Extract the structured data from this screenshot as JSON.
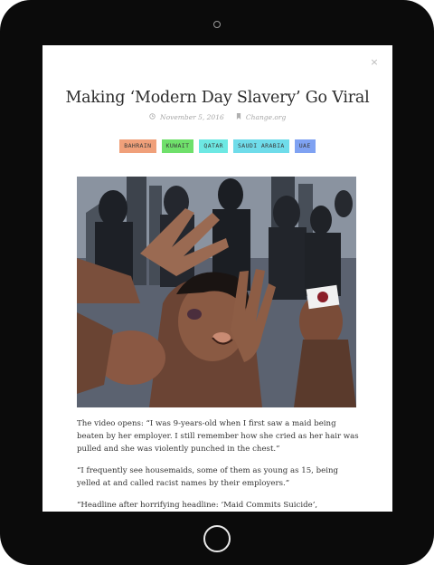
{
  "article": {
    "title": "Making ‘Modern Day Slavery’ Go Viral",
    "date": "November 5, 2016",
    "category": "Change.org",
    "close_icon": "×",
    "tags": [
      {
        "label": "BAHRAIN",
        "color": "#f0a07a"
      },
      {
        "label": "KUWAIT",
        "color": "#6fe06b"
      },
      {
        "label": "QATAR",
        "color": "#6de8e3"
      },
      {
        "label": "SAUDI ARABIA",
        "color": "#6fdcea"
      },
      {
        "label": "UAE",
        "color": "#7fa2f2"
      }
    ],
    "paragraphs": [
      "The video opens: “I was 9-years-old when I first saw a maid being beaten by her employer. I still remember how she cried as her hair was pulled and she was violently punched in the chest.”",
      "“I frequently see housemaids, some of them as young as 15, being yelled at and called racist names by their employers.”",
      "“Headline after horrifying headline: ‘Maid Commits Suicide’, ‘Construction Worker Crushed to Death’, ‘Maid Beaten’, ‘Driver Killed’ – which is"
    ]
  },
  "icons": {
    "clock": "clock-icon",
    "bookmark": "bookmark-icon",
    "close": "close-icon"
  }
}
